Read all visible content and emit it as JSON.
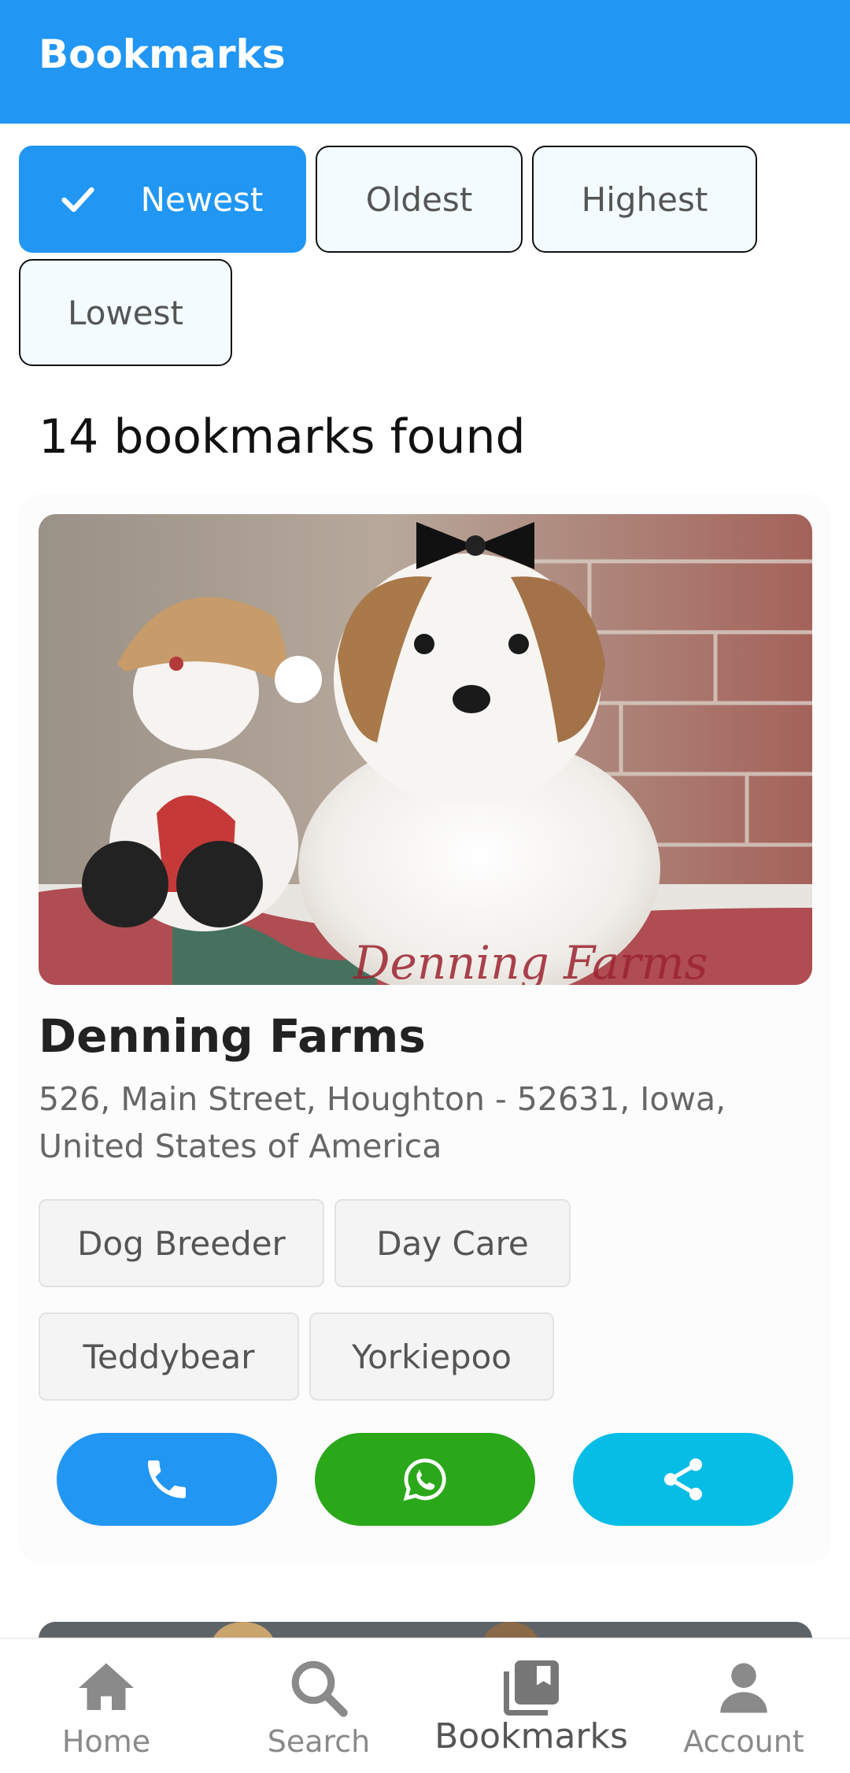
{
  "app_bar": {
    "title": "Bookmarks"
  },
  "sort_chips": [
    {
      "label": "Newest",
      "selected": true
    },
    {
      "label": "Oldest",
      "selected": false
    },
    {
      "label": "Highest",
      "selected": false
    },
    {
      "label": "Lowest",
      "selected": false
    }
  ],
  "results": {
    "count_text": "14 bookmarks found"
  },
  "listing": {
    "name": "Denning Farms",
    "address": "526, Main Street, Houghton - 52631, Iowa, United States of America",
    "photo_watermark": "Denning Farms",
    "tags": [
      "Dog Breeder",
      "Day Care",
      "Teddybear",
      "Yorkiepoo"
    ],
    "actions": [
      {
        "icon": "phone-icon",
        "color": "#2196f3"
      },
      {
        "icon": "whatsapp-icon",
        "color": "#2aa81a"
      },
      {
        "icon": "share-icon",
        "color": "#06bde6"
      }
    ]
  },
  "bottom_nav": [
    {
      "label": "Home",
      "icon": "home-icon",
      "active": false
    },
    {
      "label": "Search",
      "icon": "search-icon",
      "active": false
    },
    {
      "label": "Bookmarks",
      "icon": "bookmarks-icon",
      "active": true
    },
    {
      "label": "Account",
      "icon": "account-icon",
      "active": false
    }
  ],
  "colors": {
    "primary": "#2196f3",
    "whatsapp": "#2aa81a",
    "share": "#06bde6"
  }
}
